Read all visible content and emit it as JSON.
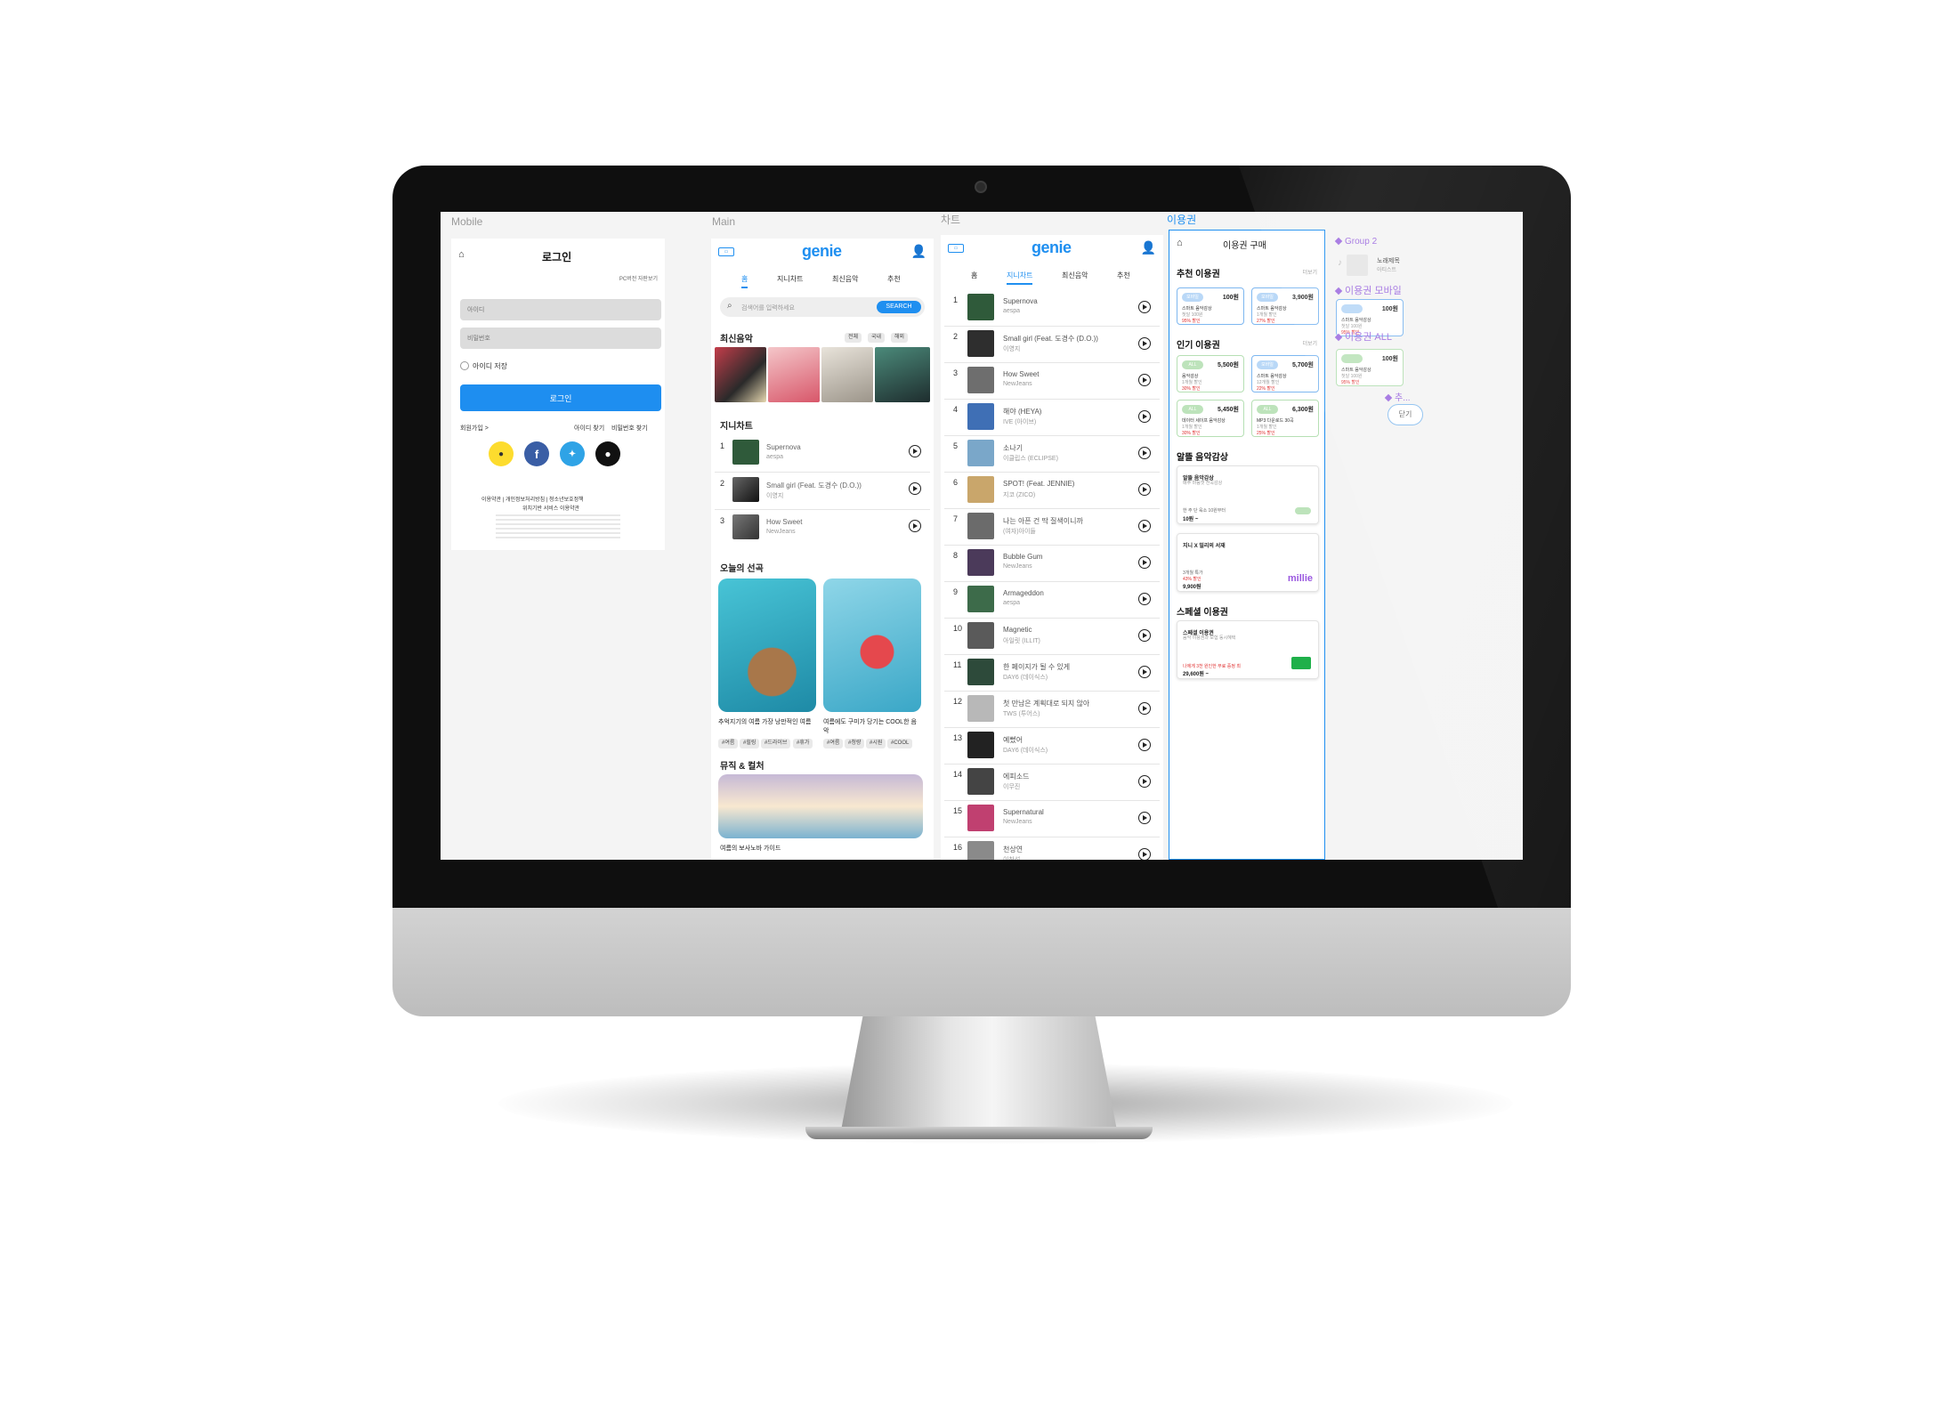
{
  "frames": {
    "mobile": "Mobile",
    "main": "Main",
    "chart": "차트",
    "pass": "이용권"
  },
  "login": {
    "title": "로그인",
    "pc_link": "PC버전 자판보기",
    "id_placeholder": "아이디",
    "pw_placeholder": "비밀번호",
    "save_id": "아이디 저장",
    "button": "로그인",
    "signup": "회원가입 >",
    "find_id": "아이디 찾기",
    "find_pw": "비밀번호 찾기",
    "footer1": "이용약관 | 개인정보처리방침 | 청소년보호정책",
    "footer2": "위치기반 서비스 이용약관"
  },
  "main": {
    "logo": "genie",
    "tabs": [
      "홈",
      "지니차트",
      "최신음악",
      "추천"
    ],
    "search_placeholder": "검색어를 입력하세요",
    "search_btn": "SEARCH",
    "latest_title": "최신음악",
    "filters": [
      "전체",
      "국내",
      "해외"
    ],
    "genie_chart_title": "지니차트",
    "chart": [
      {
        "rank": "1",
        "title": "Supernova",
        "artist": "aespa"
      },
      {
        "rank": "2",
        "title": "Small girl (Feat. 도경수 (D.O.))",
        "artist": "이영지"
      },
      {
        "rank": "3",
        "title": "How Sweet",
        "artist": "NewJeans"
      }
    ],
    "today_title": "오늘의 선곡",
    "today": [
      {
        "caption": "추억지기의 여름 가장 낭만적인 여름",
        "tags": [
          "#여름",
          "#힐링",
          "#드라이브",
          "#휴가"
        ]
      },
      {
        "caption": "여름에도 구미가 당기는 COOL한 음악",
        "tags": [
          "#여름",
          "#청량",
          "#시원",
          "#COOL"
        ]
      }
    ],
    "culture_title": "뮤직 & 컬처",
    "culture_caption": "여름의 보사노바 가이드"
  },
  "chart_page": {
    "logo": "genie",
    "tabs": [
      "홈",
      "지니차트",
      "최신음악",
      "추천"
    ],
    "rows": [
      {
        "rank": "1",
        "title": "Supernova",
        "artist": "aespa"
      },
      {
        "rank": "2",
        "title": "Small girl (Feat. 도경수 (D.O.))",
        "artist": "이영지"
      },
      {
        "rank": "3",
        "title": "How Sweet",
        "artist": "NewJeans"
      },
      {
        "rank": "4",
        "title": "해야 (HEYA)",
        "artist": "IVE (아이브)"
      },
      {
        "rank": "5",
        "title": "소나기",
        "artist": "이클립스 (ECLIPSE)"
      },
      {
        "rank": "6",
        "title": "SPOT! (Feat. JENNIE)",
        "artist": "지코 (ZICO)"
      },
      {
        "rank": "7",
        "title": "나는 아픈 건 딱 질색이니까",
        "artist": "(여자)아이들"
      },
      {
        "rank": "8",
        "title": "Bubble Gum",
        "artist": "NewJeans"
      },
      {
        "rank": "9",
        "title": "Armageddon",
        "artist": "aespa"
      },
      {
        "rank": "10",
        "title": "Magnetic",
        "artist": "아일릿 (ILLIT)"
      },
      {
        "rank": "11",
        "title": "한 페이지가 될 수 있게",
        "artist": "DAY6 (데이식스)"
      },
      {
        "rank": "12",
        "title": "첫 만남은 계획대로 되지 않아",
        "artist": "TWS (투어스)"
      },
      {
        "rank": "13",
        "title": "예뻤어",
        "artist": "DAY6 (데이식스)"
      },
      {
        "rank": "14",
        "title": "에피소드",
        "artist": "이무진"
      },
      {
        "rank": "15",
        "title": "Supernatural",
        "artist": "NewJeans"
      },
      {
        "rank": "16",
        "title": "천상연",
        "artist": "이창섭"
      }
    ]
  },
  "pass": {
    "title": "이용권 구매",
    "recommended": "추천 이용권",
    "more": "더보기",
    "rec_cards": [
      {
        "badge": "모바일",
        "price": "100원",
        "line1": "스마트 음악감상",
        "line2": "첫달 100원",
        "line3": "95% 할인"
      },
      {
        "badge": "모바일",
        "price": "3,900원",
        "line1": "스마트 음악감상",
        "line2": "1개월 할인",
        "line3": "27% 할인"
      }
    ],
    "popular": "인기 이용권",
    "pop_cards": [
      {
        "badge": "ALL",
        "price": "5,500원",
        "line1": "음악감상",
        "line2": "1개월 할인",
        "line3": "30% 할인"
      },
      {
        "badge": "모바일",
        "price": "5,700원",
        "line1": "스마트 음악감상",
        "line2": "12개월 할인",
        "line3": "22% 할인"
      },
      {
        "badge": "ALL",
        "price": "5,450원",
        "line1": "데이터 세이프 음악감상",
        "line2": "1개월 할인",
        "line3": "30% 할인"
      },
      {
        "badge": "ALL",
        "price": "6,300원",
        "line1": "MP3 다운로드 30곡",
        "line2": "1개월 할인",
        "line3": "25% 할인"
      }
    ],
    "smart": "알뜰 음악감상",
    "smart_box": {
      "title": "알뜰 음악감상",
      "desc": "매주 마음껏 전곡감상",
      "note": "한 주 단 육소 10원부터",
      "price": "10원 ~"
    },
    "millie_box": {
      "title": "지니 X 밀리의 서재",
      "note": "3개월 특가",
      "discount": "43% 할인",
      "price": "9,900원",
      "brand": "millie"
    },
    "special": "스페셜 이용권",
    "special_box": {
      "title": "스페셜 이용권",
      "desc": "음악 이용권과 보험 동시혜택",
      "note": "나에게 3천 원인한 무료 증정 최",
      "price": "29,600원 ~"
    }
  },
  "side": {
    "group": "Group 2",
    "song": "노래제목",
    "artist": "아티스트",
    "mobile_pass": "이용권 모바일",
    "all_pass": "이용권 ALL",
    "more": "추...",
    "cards": [
      {
        "price": "100원",
        "line1": "스마트 음악감상",
        "line2": "첫달 100원",
        "line3": "95% 할인"
      },
      {
        "price": "100원",
        "line1": "스마트 음악감상",
        "line2": "첫달 100원",
        "line3": "95% 할인"
      }
    ],
    "close": "닫기"
  }
}
